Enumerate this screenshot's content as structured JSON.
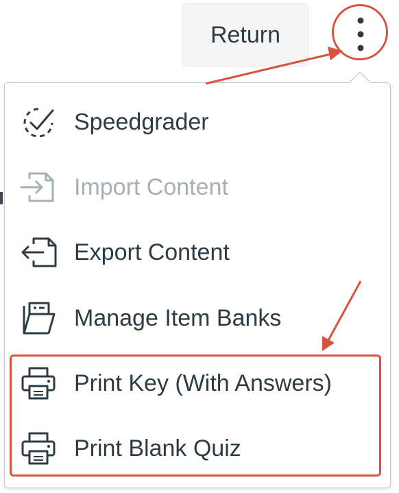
{
  "header": {
    "return_label": "Return",
    "kebab_icon": "kebab-vertical-icon"
  },
  "menu": {
    "items": [
      {
        "label": "Speedgrader",
        "icon": "speedgrader-icon",
        "disabled": false
      },
      {
        "label": "Import Content",
        "icon": "import-icon",
        "disabled": true
      },
      {
        "label": "Export Content",
        "icon": "export-icon",
        "disabled": false
      },
      {
        "label": "Manage Item Banks",
        "icon": "item-bank-folder-icon",
        "disabled": false
      },
      {
        "label": "Print Key (With Answers)",
        "icon": "printer-icon",
        "disabled": false
      },
      {
        "label": "Print Blank Quiz",
        "icon": "printer-icon",
        "disabled": false
      }
    ]
  },
  "annotations": {
    "highlight_color": "#d9523f"
  },
  "colors": {
    "text": "#2d3b45",
    "disabled_text": "#a5afb5",
    "button_bg": "#f5f5f5"
  }
}
